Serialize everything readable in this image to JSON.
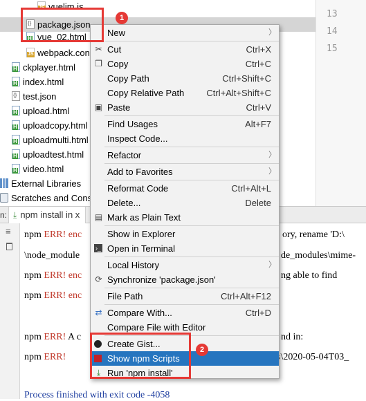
{
  "tree": {
    "items": [
      {
        "label": "vuelim.js",
        "icon": "js-file-icon"
      },
      {
        "label": "package.json",
        "icon": "json-file-icon"
      },
      {
        "label": "vue_02.html",
        "icon": "html-file-icon"
      },
      {
        "label": "webpack.con",
        "icon": "js-file-icon"
      },
      {
        "label": "ckplayer.html",
        "icon": "html-file-icon"
      },
      {
        "label": "index.html",
        "icon": "html-file-icon"
      },
      {
        "label": "test.json",
        "icon": "json-file-icon"
      },
      {
        "label": "upload.html",
        "icon": "html-file-icon"
      },
      {
        "label": "uploadcopy.html",
        "icon": "html-file-icon"
      },
      {
        "label": "uploadmulti.html",
        "icon": "html-file-icon"
      },
      {
        "label": "uploadtest.html",
        "icon": "html-file-icon"
      },
      {
        "label": "video.html",
        "icon": "html-file-icon"
      },
      {
        "label": "External Libraries",
        "icon": "library-icon"
      },
      {
        "label": "Scratches and Conso",
        "icon": "scratches-icon"
      }
    ]
  },
  "gutter": {
    "lines": [
      "13",
      "14",
      "15"
    ]
  },
  "run": {
    "label": "n:",
    "tab_label": "npm install in x"
  },
  "console": {
    "lines": [
      {
        "prefix": "npm ",
        "err": "ERR!",
        "rest": " enc",
        "tail": "ory, rename 'D:\\"
      },
      {
        "prefix": "\\node_module",
        "err": "",
        "rest": "",
        "tail": "de_modules\\mime-"
      },
      {
        "prefix": "npm ",
        "err": "ERR!",
        "rest": " enc",
        "tail": "ng able to find"
      },
      {
        "prefix": "npm ",
        "err": "ERR!",
        "rest": " enc",
        "tail": ""
      },
      {
        "prefix": "npm ",
        "err": "ERR!",
        "rest": " A c",
        "tail": "nd in:"
      },
      {
        "prefix": "npm ",
        "err": "ERR!",
        "rest": "",
        "tail": "s\\2020-05-04T03_"
      }
    ],
    "exit_line": "Process finished with exit code -4058"
  },
  "menu": {
    "items": [
      {
        "label": "New",
        "shortcut": "",
        "submenu": true,
        "icon": ""
      },
      {
        "label": "Cut",
        "shortcut": "Ctrl+X",
        "icon": "scissors-icon"
      },
      {
        "label": "Copy",
        "shortcut": "Ctrl+C",
        "icon": "copy-icon"
      },
      {
        "label": "Copy Path",
        "shortcut": "Ctrl+Shift+C",
        "icon": ""
      },
      {
        "label": "Copy Relative Path",
        "shortcut": "Ctrl+Alt+Shift+C",
        "icon": ""
      },
      {
        "label": "Paste",
        "shortcut": "Ctrl+V",
        "icon": "clipboard-icon"
      },
      {
        "label": "Find Usages",
        "shortcut": "Alt+F7",
        "icon": ""
      },
      {
        "label": "Inspect Code...",
        "shortcut": "",
        "icon": ""
      },
      {
        "label": "Refactor",
        "shortcut": "",
        "submenu": true,
        "icon": ""
      },
      {
        "label": "Add to Favorites",
        "shortcut": "",
        "submenu": true,
        "icon": ""
      },
      {
        "label": "Reformat Code",
        "shortcut": "Ctrl+Alt+L",
        "icon": ""
      },
      {
        "label": "Delete...",
        "shortcut": "Delete",
        "icon": ""
      },
      {
        "label": "Mark as Plain Text",
        "shortcut": "",
        "icon": "plain-text-icon"
      },
      {
        "label": "Show in Explorer",
        "shortcut": "",
        "icon": ""
      },
      {
        "label": "Open in Terminal",
        "shortcut": "",
        "icon": "terminal-icon"
      },
      {
        "label": "Local History",
        "shortcut": "",
        "submenu": true,
        "icon": ""
      },
      {
        "label": "Synchronize 'package.json'",
        "shortcut": "",
        "icon": "sync-icon"
      },
      {
        "label": "File Path",
        "shortcut": "Ctrl+Alt+F12",
        "icon": ""
      },
      {
        "label": "Compare With...",
        "shortcut": "Ctrl+D",
        "icon": "compare-icon"
      },
      {
        "label": "Compare File with Editor",
        "shortcut": "",
        "icon": ""
      },
      {
        "label": "Create Gist...",
        "shortcut": "",
        "icon": "github-icon"
      },
      {
        "label": "Show npm Scripts",
        "shortcut": "",
        "icon": "npm-icon",
        "highlighted": true
      },
      {
        "label": "Run 'npm install'",
        "shortcut": "",
        "icon": "npm-run-icon"
      }
    ]
  },
  "annotations": {
    "badge1": "1",
    "badge2": "2"
  },
  "colors": {
    "highlight": "#2675bf",
    "annotation_red": "#e53935",
    "error_red": "#c0392b",
    "exit_blue": "#1f3fa0"
  }
}
